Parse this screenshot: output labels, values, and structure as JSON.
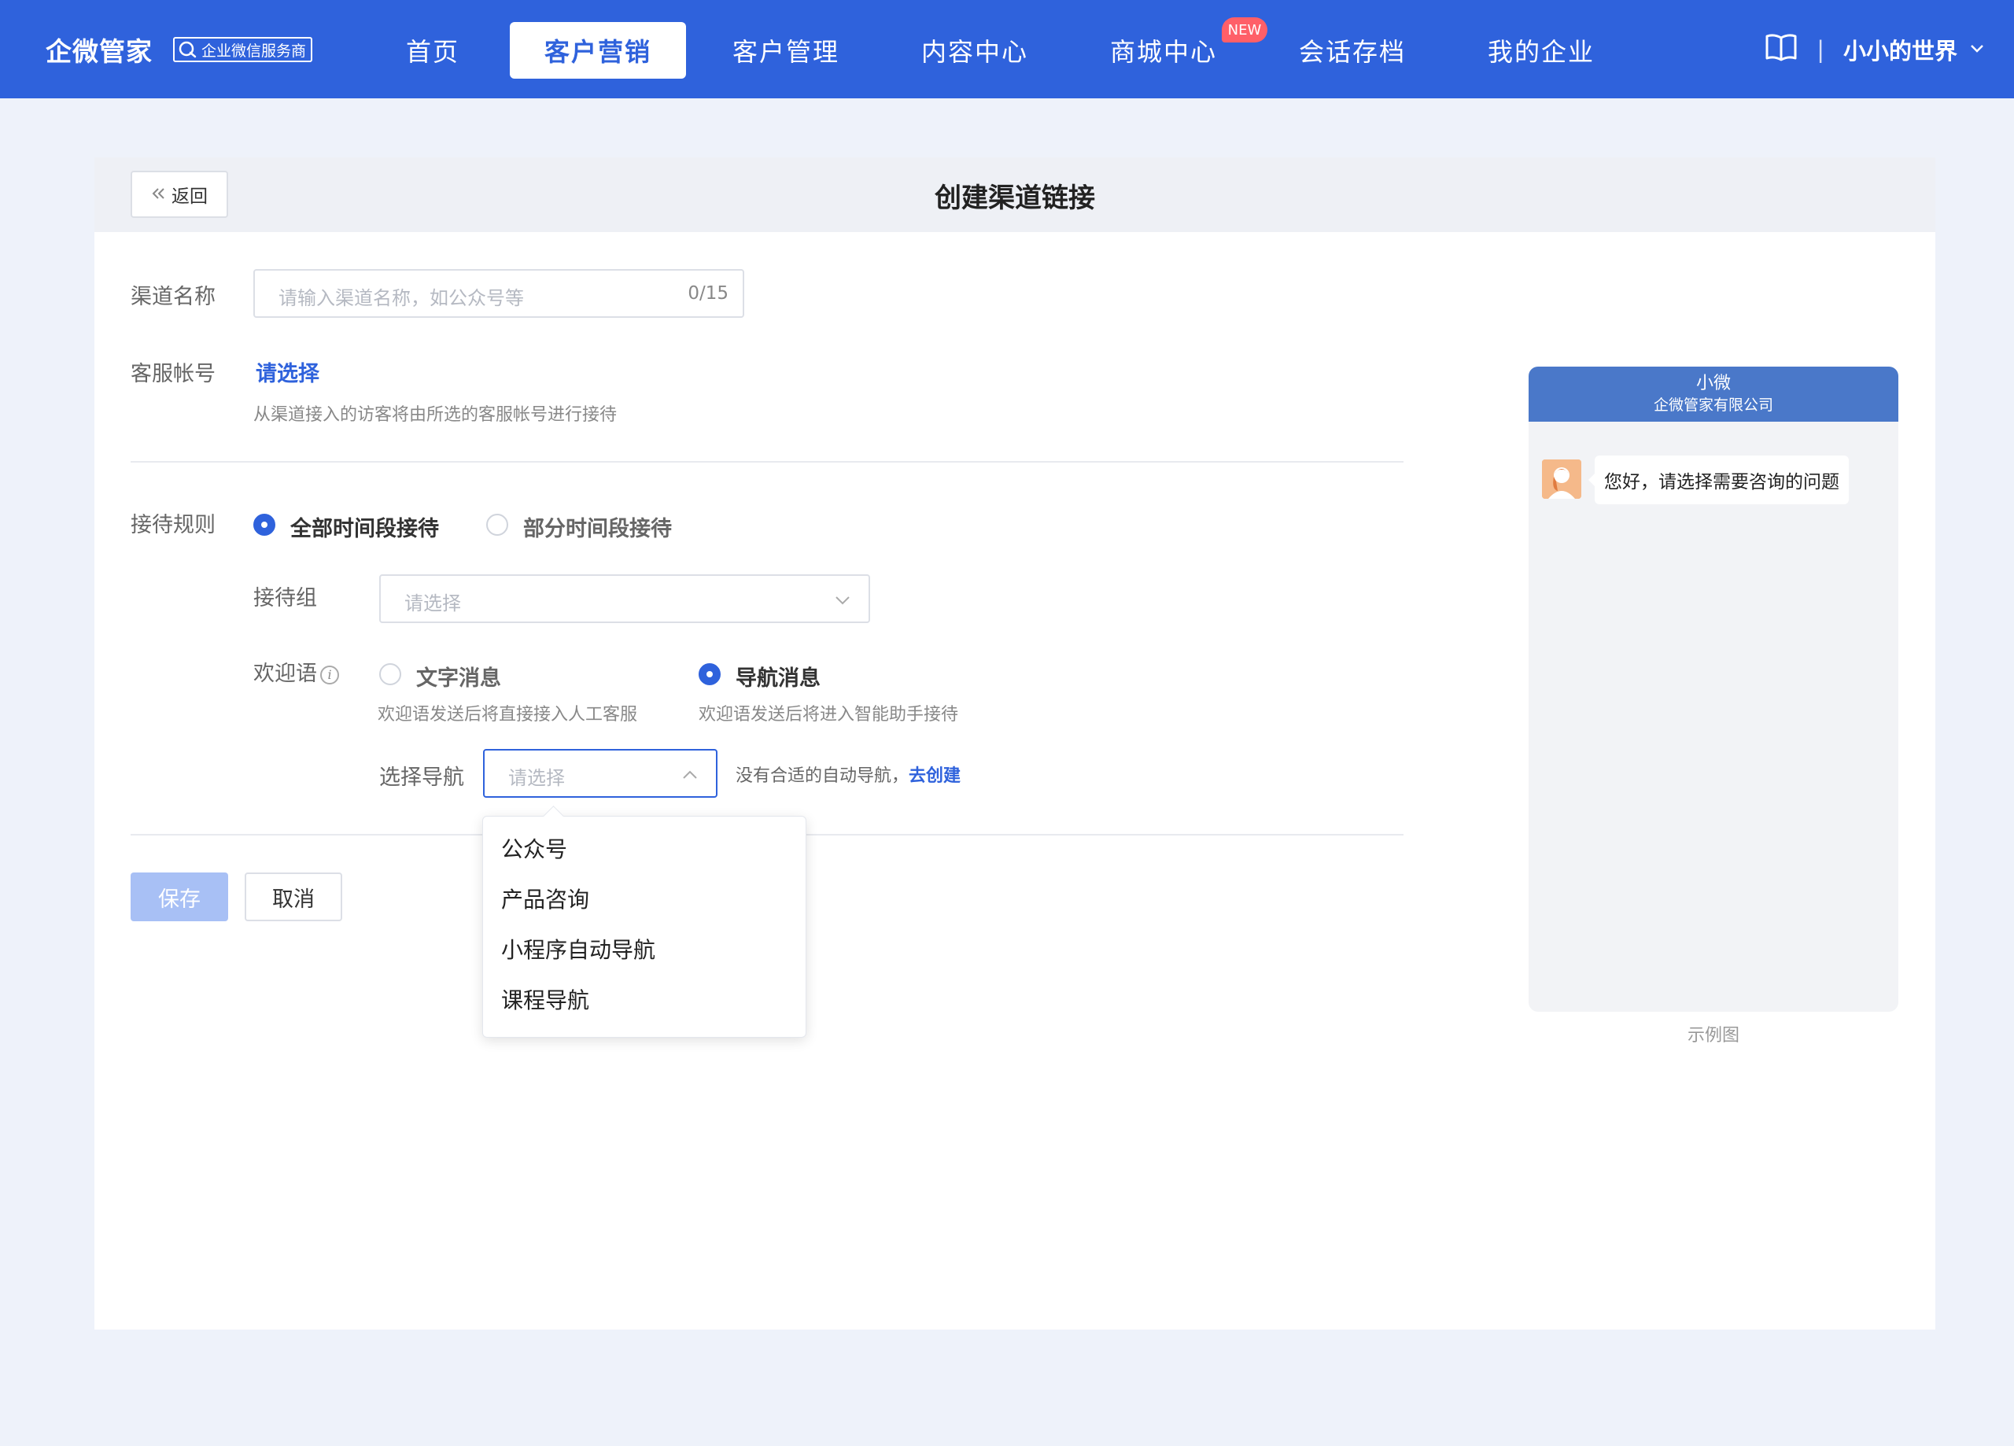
{
  "brand": {
    "name": "企微管家",
    "badge": "企业微信服务商"
  },
  "nav": [
    {
      "label": "首页"
    },
    {
      "label": "客户营销"
    },
    {
      "label": "客户管理"
    },
    {
      "label": "内容中心"
    },
    {
      "label": "商城中心"
    },
    {
      "label": "会话存档"
    },
    {
      "label": "我的企业"
    }
  ],
  "nav_active": "客户营销",
  "new_badge": "NEW",
  "user": {
    "name": "小小的世界",
    "separator": "|"
  },
  "header": {
    "back_label": "返回",
    "title": "创建渠道链接"
  },
  "form": {
    "channel_name": {
      "label": "渠道名称",
      "placeholder": "请输入渠道名称，如公众号等",
      "counter": "0/15"
    },
    "service_account": {
      "label": "客服帐号",
      "value": "请选择",
      "hint": "从渠道接入的访客将由所选的客服帐号进行接待"
    },
    "reception_rule": {
      "label": "接待规则",
      "options": [
        {
          "label": "全部时间段接待",
          "selected": true
        },
        {
          "label": "部分时间段接待",
          "selected": false
        }
      ]
    },
    "reception_group": {
      "label": "接待组",
      "placeholder": "请选择"
    },
    "welcome": {
      "label": "欢迎语",
      "info_icon": "i",
      "options": [
        {
          "label": "文字消息",
          "desc": "欢迎语发送后将直接接入人工客服",
          "selected": false
        },
        {
          "label": "导航消息",
          "desc": "欢迎语发送后将进入智能助手接待",
          "selected": true
        }
      ]
    },
    "navigation": {
      "label": "选择导航",
      "placeholder": "请选择",
      "hint": "没有合适的自动导航，",
      "create_link": "去创建",
      "options": [
        "公众号",
        "产品咨询",
        "小程序自动导航",
        "课程导航"
      ]
    },
    "save_label": "保存",
    "cancel_label": "取消"
  },
  "preview": {
    "title": "小微",
    "subtitle": "企微管家有限公司",
    "message": "您好，请选择需要咨询的问题",
    "caption": "示例图"
  },
  "colors": {
    "primary": "#2f62dc",
    "topbar": "#2f62dc",
    "page_bg": "#eef2fa",
    "new_badge": "#ff5f68",
    "preview_header": "#4a78c9",
    "save_disabled": "#a8c0f5"
  },
  "icons": {
    "brand_badge": "chat-bubble-icon",
    "manual": "book-icon",
    "user_menu": "chevron-down-icon",
    "back": "double-chevron-left-icon",
    "info": "info-icon",
    "select_closed": "chevron-down-icon",
    "select_open": "chevron-up-icon",
    "avatar": "avatar-icon"
  }
}
